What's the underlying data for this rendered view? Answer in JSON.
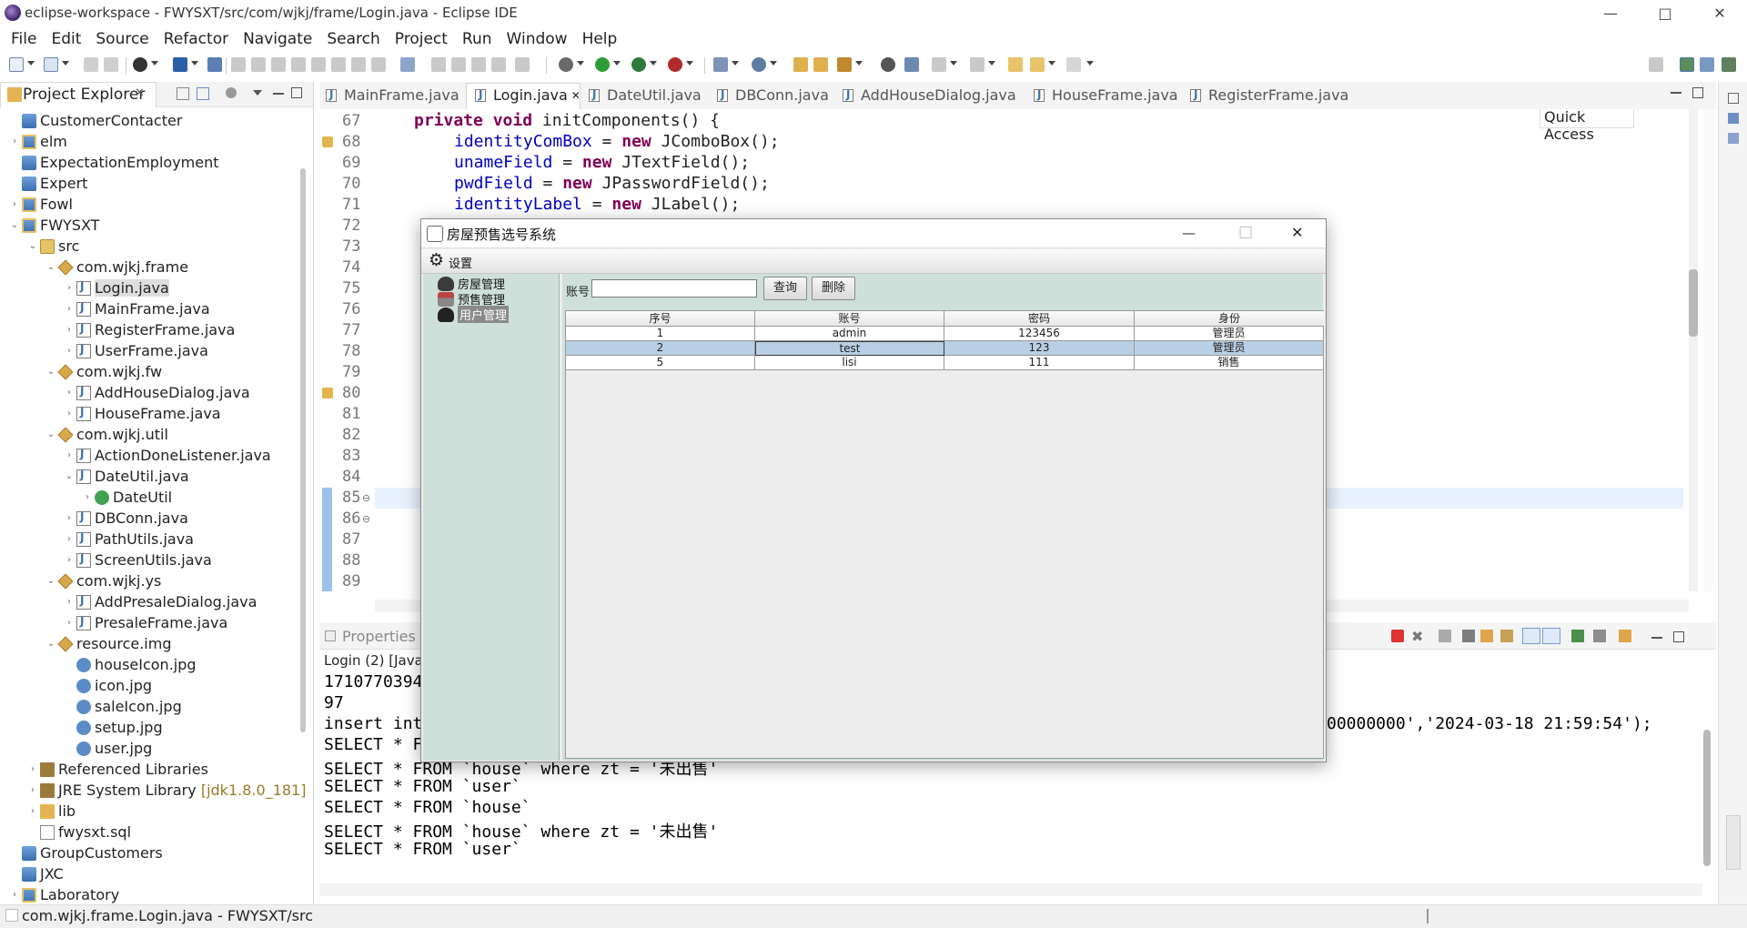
{
  "window": {
    "title": "eclipse-workspace - FWYSXT/src/com/wjkj/frame/Login.java - Eclipse IDE",
    "min": "—",
    "max": "□",
    "close": "✕"
  },
  "menu": [
    "File",
    "Edit",
    "Source",
    "Refactor",
    "Navigate",
    "Search",
    "Project",
    "Run",
    "Window",
    "Help"
  ],
  "quick_access": "Quick Access",
  "project_explorer": {
    "title": "Project Explorer",
    "close": "✕",
    "tree": [
      {
        "label": "CustomerContacter",
        "icon": "project-icon"
      },
      {
        "label": "elm",
        "icon": "project-icon"
      },
      {
        "label": "ExpectationEmployment",
        "icon": "project-icon"
      },
      {
        "label": "Expert",
        "icon": "project-icon"
      },
      {
        "label": "Fowl",
        "icon": "project-icon"
      },
      {
        "label": "FWYSXT",
        "icon": "project-icon"
      },
      {
        "label": "src",
        "icon": "source-folder-icon"
      },
      {
        "label": "com.wjkj.frame",
        "icon": "package-icon"
      },
      {
        "label": "Login.java",
        "icon": "java-file-icon"
      },
      {
        "label": "MainFrame.java",
        "icon": "java-file-icon"
      },
      {
        "label": "RegisterFrame.java",
        "icon": "java-file-icon"
      },
      {
        "label": "UserFrame.java",
        "icon": "java-file-icon"
      },
      {
        "label": "com.wjkj.fw",
        "icon": "package-icon"
      },
      {
        "label": "AddHouseDialog.java",
        "icon": "java-file-icon"
      },
      {
        "label": "HouseFrame.java",
        "icon": "java-file-icon"
      },
      {
        "label": "com.wjkj.util",
        "icon": "package-icon"
      },
      {
        "label": "ActionDoneListener.java",
        "icon": "java-file-icon"
      },
      {
        "label": "DateUtil.java",
        "icon": "java-file-icon"
      },
      {
        "label": "DateUtil",
        "icon": "class-icon"
      },
      {
        "label": "DBConn.java",
        "icon": "java-file-icon"
      },
      {
        "label": "PathUtils.java",
        "icon": "java-file-icon"
      },
      {
        "label": "ScreenUtils.java",
        "icon": "java-file-icon"
      },
      {
        "label": "com.wjkj.ys",
        "icon": "package-icon"
      },
      {
        "label": "AddPresaleDialog.java",
        "icon": "java-file-icon"
      },
      {
        "label": "PresaleFrame.java",
        "icon": "java-file-icon"
      },
      {
        "label": "resource.img",
        "icon": "package-icon"
      },
      {
        "label": "houseIcon.jpg",
        "icon": "image-file-icon"
      },
      {
        "label": "icon.jpg",
        "icon": "image-file-icon"
      },
      {
        "label": "saleIcon.jpg",
        "icon": "image-file-icon"
      },
      {
        "label": "setup.jpg",
        "icon": "image-file-icon"
      },
      {
        "label": "user.jpg",
        "icon": "image-file-icon"
      },
      {
        "label": "Referenced Libraries",
        "icon": "library-icon"
      },
      {
        "label": "JRE System Library",
        "suffix": "[jdk1.8.0_181]",
        "icon": "library-icon"
      },
      {
        "label": "lib",
        "icon": "folder-icon"
      },
      {
        "label": "fwysxt.sql",
        "icon": "sql-file-icon"
      },
      {
        "label": "GroupCustomers",
        "icon": "project-icon"
      },
      {
        "label": "JXC",
        "icon": "project-icon"
      },
      {
        "label": "Laboratory",
        "icon": "project-icon"
      }
    ]
  },
  "editor": {
    "tabs": [
      "MainFrame.java",
      "Login.java",
      "DateUtil.java",
      "DBConn.java",
      "AddHouseDialog.java",
      "HouseFrame.java",
      "RegisterFrame.java"
    ],
    "active_tab": "Login.java",
    "line_numbers": [
      "67",
      "68",
      "69",
      "70",
      "71",
      "72",
      "73",
      "74",
      "75",
      "76",
      "77",
      "78",
      "79",
      "80",
      "81",
      "82",
      "83",
      "84",
      "85",
      "86",
      "87",
      "88",
      "89"
    ],
    "code": {
      "l67_kw": "private void ",
      "l67_rest": "initComponents() {",
      "l68_f": "identityComBox",
      "l68_a": " = ",
      "l68_kw": "new ",
      "l68_t": "JComboBox();",
      "l69_f": "unameField",
      "l69_a": " = ",
      "l69_kw": "new ",
      "l69_t": "JTextField();",
      "l70_f": "pwdField",
      "l70_a": " = ",
      "l70_kw": "new ",
      "l70_t": "JPasswordField();",
      "l71_f": "identityLabel",
      "l71_a": " = ",
      "l71_kw": "new ",
      "l71_t": "JLabel();"
    }
  },
  "console": {
    "properties_tab": "Properties",
    "launch": "Login (2) [Java .",
    "lines": [
      "1710770394",
      "97",
      "insert int",
      "SELECT * F",
      "SELECT * FROM `house` where zt = '未出售'",
      "SELECT * FROM `user`",
      "SELECT * FROM `house`",
      "SELECT * FROM `house` where zt = '未出售'",
      "SELECT * FROM `user`"
    ],
    "insert_tail": "00000000','2024-03-18 21:59:54');"
  },
  "statusbar": "com.wjkj.frame.Login.java - FWYSXT/src",
  "dialog": {
    "title": "房屋预售选号系统",
    "menu_settings": "设置",
    "nav": [
      "房屋管理",
      "预售管理",
      "用户管理"
    ],
    "search_label": "账号",
    "search_value": "",
    "query_button": "查询",
    "delete_button": "删除",
    "table_headers": [
      "序号",
      "账号",
      "密码",
      "身份"
    ],
    "rows": [
      [
        "1",
        "admin",
        "123456",
        "管理员"
      ],
      [
        "2",
        "test",
        "123",
        "管理员"
      ],
      [
        "5",
        "lisi",
        "111",
        "销售"
      ]
    ],
    "selected_row": 1
  }
}
